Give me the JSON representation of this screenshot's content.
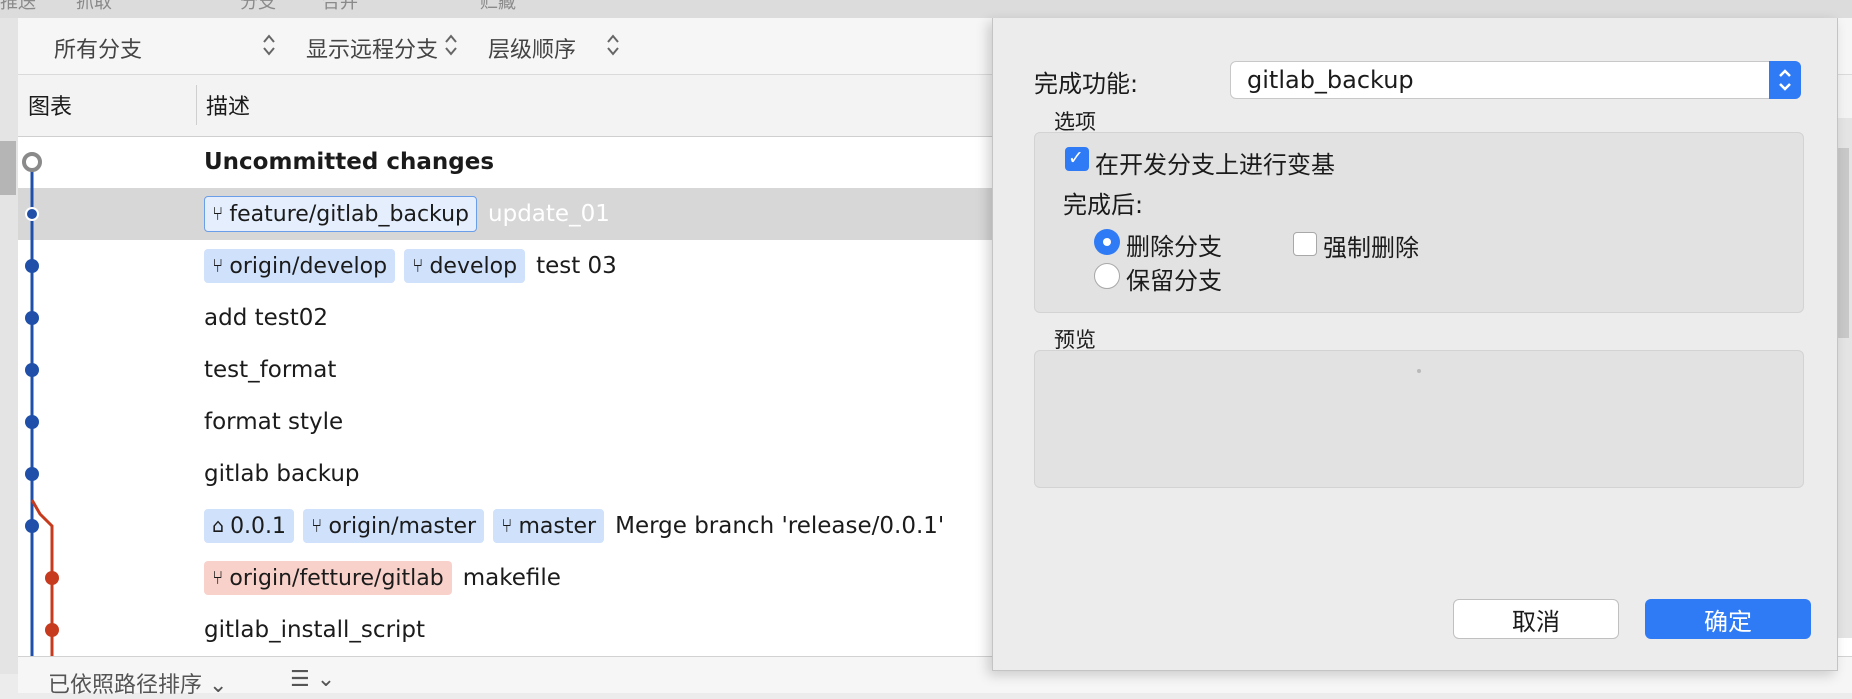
{
  "toolbar_strip": {
    "items": [
      "推送",
      "抓取",
      "分支",
      "合并",
      "贮藏"
    ]
  },
  "filter_bar": {
    "branches": "所有分支",
    "remote": "显示远程分支",
    "order": "层级顺序"
  },
  "columns": {
    "graph": "图表",
    "description": "描述"
  },
  "commits": [
    {
      "tags": [],
      "message": "Uncommitted changes"
    },
    {
      "tags": [
        {
          "icon": "branch-icon",
          "label": "feature/gitlab_backup"
        }
      ],
      "message": "update_01"
    },
    {
      "tags": [
        {
          "icon": "branch-icon",
          "label": "origin/develop"
        },
        {
          "icon": "branch-icon",
          "label": "develop"
        }
      ],
      "message": "test 03"
    },
    {
      "tags": [],
      "message": "add test02"
    },
    {
      "tags": [],
      "message": "test_format"
    },
    {
      "tags": [],
      "message": "format style"
    },
    {
      "tags": [],
      "message": "gitlab backup"
    },
    {
      "tags": [
        {
          "icon": "tag-icon",
          "label": "0.0.1"
        },
        {
          "icon": "branch-icon",
          "label": "origin/master"
        },
        {
          "icon": "branch-icon",
          "label": "master"
        }
      ],
      "message": "Merge branch 'release/0.0.1'"
    },
    {
      "tags": [
        {
          "icon": "branch-icon",
          "label": "origin/fetture/gitlab"
        }
      ],
      "message": "makefile"
    },
    {
      "tags": [],
      "message": "gitlab_install_script"
    }
  ],
  "bottom_bar": {
    "sort": "已依照路径排序"
  },
  "dialog": {
    "finish_label": "完成功能:",
    "finish_value": "gitlab_backup",
    "options_title": "选项",
    "rebase_label": "在开发分支上进行变基",
    "rebase_checked": true,
    "after_label": "完成后:",
    "delete_branch": "删除分支",
    "force_delete": "强制删除",
    "keep_branch": "保留分支",
    "selected_after": "删除分支",
    "preview_title": "预览",
    "cancel": "取消",
    "ok": "确定"
  },
  "colors": {
    "accent": "#2f7bf5",
    "graph_blue": "#1f4fa8",
    "graph_red": "#c63b1e",
    "branch_tag": "#cfe1fb",
    "remote_red_tag": "#f8d2ca"
  }
}
